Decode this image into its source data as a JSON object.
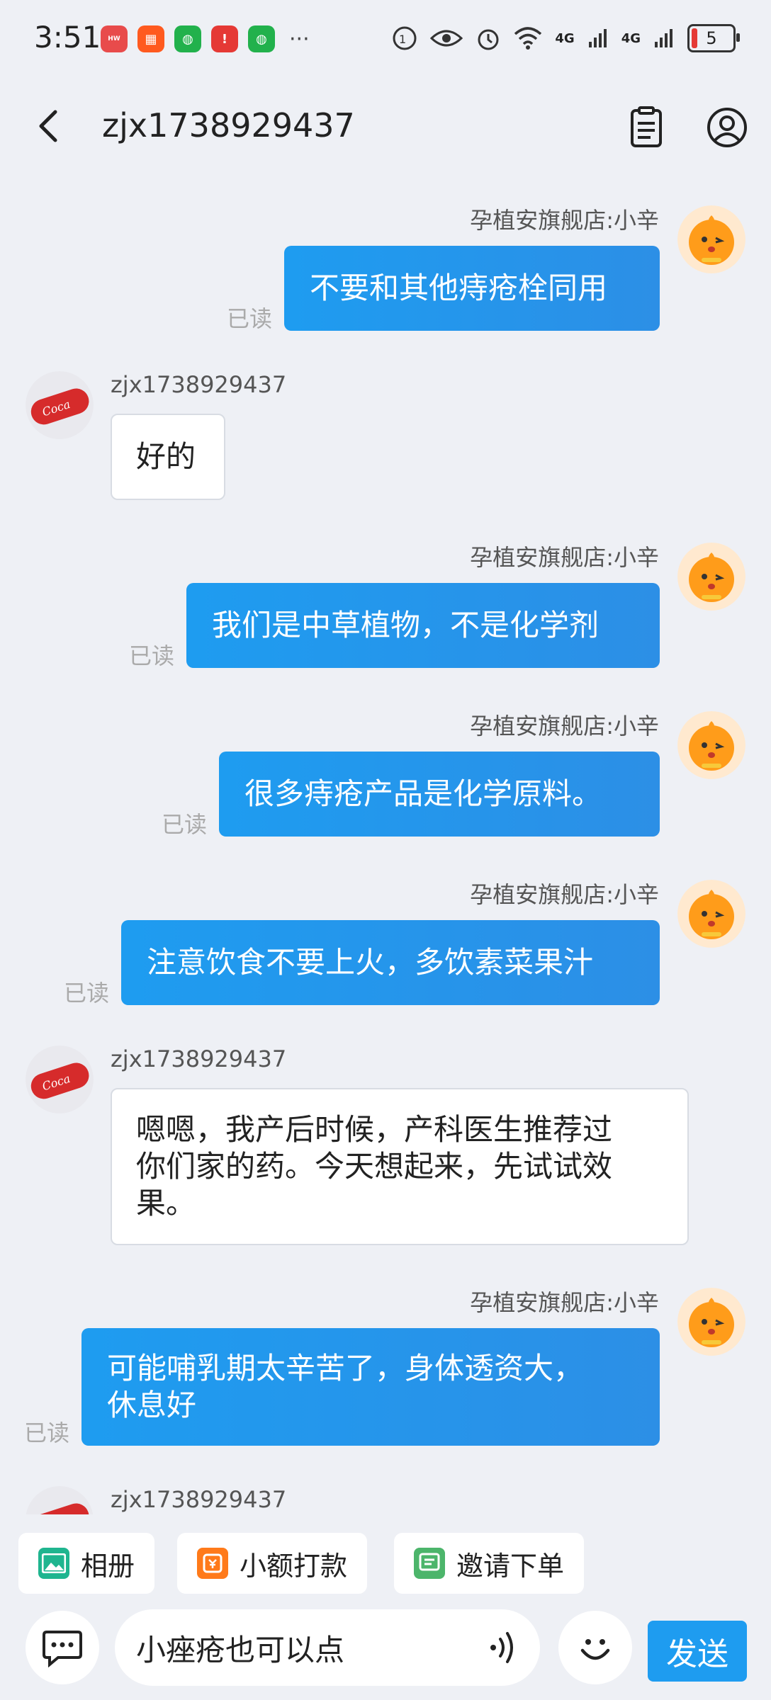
{
  "status_bar": {
    "time": "3:51",
    "battery": "5",
    "network_1": "4G",
    "network_2": "4G"
  },
  "header": {
    "title": "zjx1738929437"
  },
  "messages": [
    {
      "sender": "孕植安旗舰店:小辛",
      "text": "不要和其他痔疮栓同用",
      "read": "已读"
    },
    {
      "sender": "zjx1738929437",
      "text": "好的"
    },
    {
      "sender": "孕植安旗舰店:小辛",
      "text": "我们是中草植物，不是化学剂",
      "read": "已读"
    },
    {
      "sender": "孕植安旗舰店:小辛",
      "text": "很多痔疮产品是化学原料。",
      "read": "已读"
    },
    {
      "sender": "孕植安旗舰店:小辛",
      "text": "注意饮食不要上火，多饮素菜果汁",
      "read": "已读"
    },
    {
      "sender": "zjx1738929437",
      "text_lines": [
        "嗯嗯，我产后时候，产科医生推荐过",
        "你们家的药。今天想起来，先试试效",
        "果。"
      ]
    },
    {
      "sender": "孕植安旗舰店:小辛",
      "text_lines": [
        "可能哺乳期太辛苦了，身体透资大，",
        "休息好"
      ],
      "read": "已读"
    },
    {
      "sender": "zjx1738929437"
    }
  ],
  "quick_actions": [
    "相册",
    "小额打款",
    "邀请下单"
  ],
  "input": {
    "value": "小痤疮也可以点"
  },
  "send_label": "发送"
}
